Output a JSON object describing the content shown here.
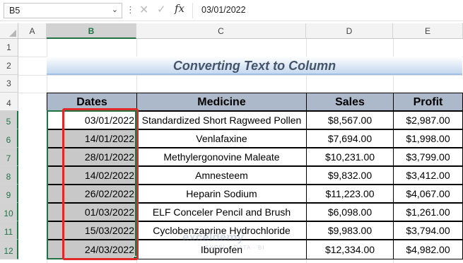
{
  "formula_bar": {
    "name_box": "B5",
    "name_box_dropdown": "⌄",
    "cancel_icon": "✕",
    "enter_icon": "✓",
    "fx_label": "fx",
    "value": "03/01/2022"
  },
  "columns": [
    "A",
    "B",
    "C",
    "D",
    "E"
  ],
  "rows": [
    "1",
    "2",
    "3",
    "4",
    "5",
    "6",
    "7",
    "8",
    "9",
    "10",
    "11",
    "12"
  ],
  "title": "Converting Text to Column",
  "table": {
    "headers": [
      "Dates",
      "Medicine",
      "Sales",
      "Profit"
    ],
    "rows": [
      {
        "date": "03/01/2022",
        "medicine": "Standardized Short Ragweed Pollen",
        "sales": "$8,567.00",
        "profit": "$2,987.00"
      },
      {
        "date": "14/01/2022",
        "medicine": "Venlafaxine",
        "sales": "$7,694.00",
        "profit": "$1,998.00"
      },
      {
        "date": "28/01/2022",
        "medicine": "Methylergonovine Maleate",
        "sales": "$10,231.00",
        "profit": "$3,799.00"
      },
      {
        "date": "14/02/2022",
        "medicine": "Amnesteem",
        "sales": "$9,832.00",
        "profit": "$3,412.00"
      },
      {
        "date": "26/02/2022",
        "medicine": "Heparin Sodium",
        "sales": "$11,223.00",
        "profit": "$4,067.00"
      },
      {
        "date": "01/03/2022",
        "medicine": "ELF Conceler Pencil and Brush",
        "sales": "$6,098.00",
        "profit": "$1,261.00"
      },
      {
        "date": "15/03/2022",
        "medicine": "Cyclobenzaprine Hydrochloride",
        "sales": "$9,983.00",
        "profit": "$3,794.00"
      },
      {
        "date": "24/03/2022",
        "medicine": "Ibuprofen",
        "sales": "$12,334.00",
        "profit": "$4,982.00"
      }
    ]
  },
  "watermark": {
    "name": "exceldemy",
    "tagline": "EXCEL · DATA · BI"
  },
  "colors": {
    "accent": "#217346",
    "header_fill": "#acb9ca",
    "highlight_box": "#e02a2a",
    "title_text": "#44546a"
  }
}
